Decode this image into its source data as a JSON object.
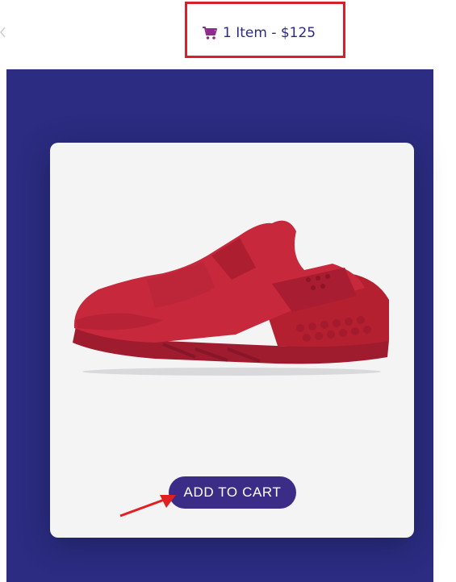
{
  "header": {
    "back_icon": "chevron-left-icon",
    "cart": {
      "icon": "shopping-cart-icon",
      "summary": "1 Item - $125",
      "icon_color": "#8e2b8e",
      "text_color": "#2c2a7e"
    },
    "highlight_color": "#d8202c"
  },
  "product": {
    "image": "red-sneaker-image",
    "shoe_color": "#c8283c",
    "card_color": "#f4f4f5",
    "add_to_cart_label": "ADD TO CART",
    "button_color": "#3b2d87"
  },
  "stage": {
    "background": "#2b2c82"
  },
  "annotation": {
    "pointer": "red-arrow-icon",
    "color": "#e02020"
  }
}
